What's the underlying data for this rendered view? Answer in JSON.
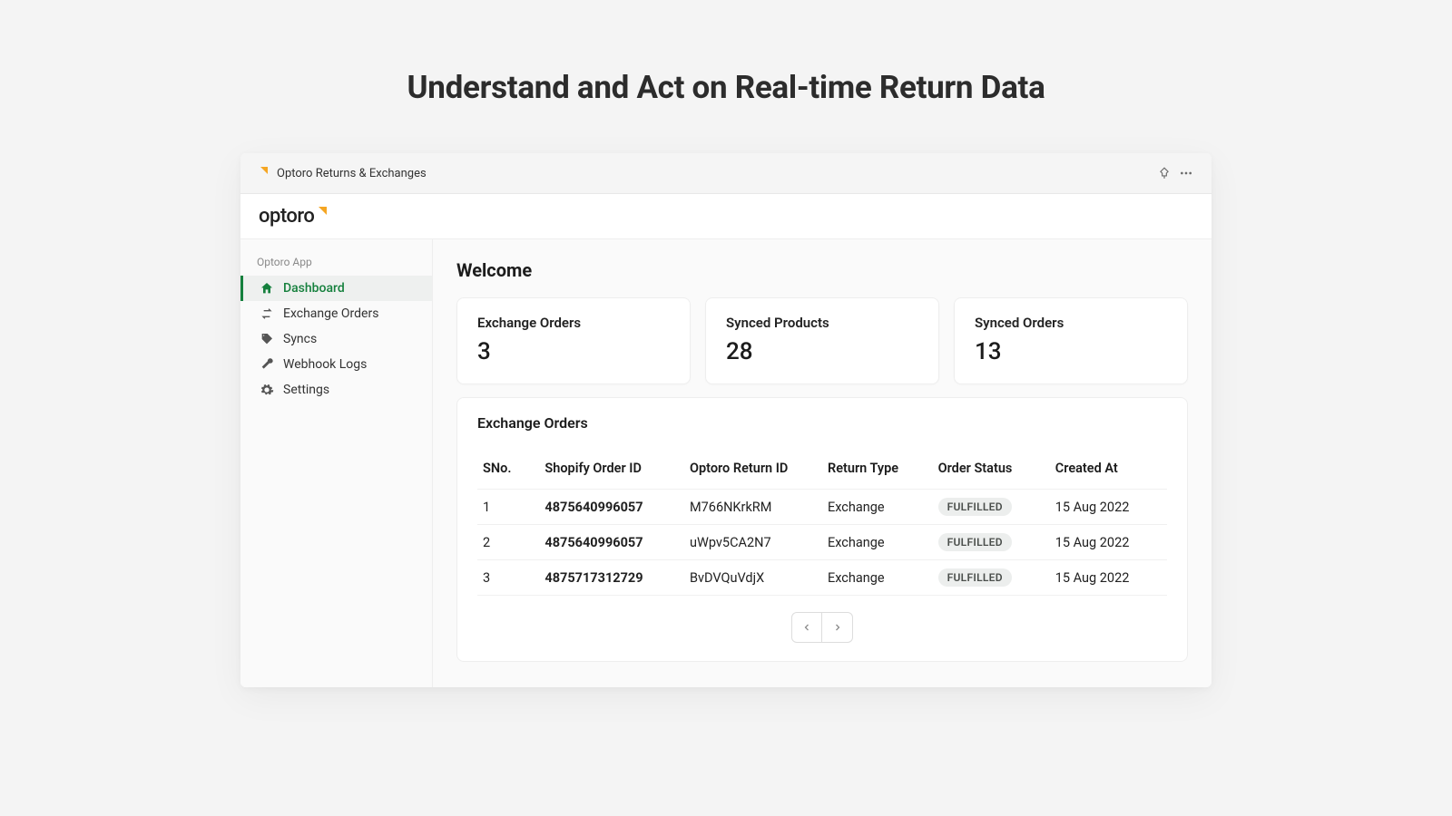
{
  "hero": {
    "title": "Understand and Act on Real-time Return Data"
  },
  "window": {
    "title": "Optoro Returns & Exchanges"
  },
  "brand": {
    "name": "optoro"
  },
  "sidebar": {
    "section_label": "Optoro App",
    "items": [
      {
        "label": "Dashboard",
        "icon": "home-icon",
        "active": true
      },
      {
        "label": "Exchange Orders",
        "icon": "exchange-icon",
        "active": false
      },
      {
        "label": "Syncs",
        "icon": "tag-icon",
        "active": false
      },
      {
        "label": "Webhook Logs",
        "icon": "wrench-icon",
        "active": false
      },
      {
        "label": "Settings",
        "icon": "gear-icon",
        "active": false
      }
    ]
  },
  "main": {
    "title": "Welcome",
    "stats": [
      {
        "label": "Exchange Orders",
        "value": "3"
      },
      {
        "label": "Synced Products",
        "value": "28"
      },
      {
        "label": "Synced Orders",
        "value": "13"
      }
    ],
    "orders_table": {
      "title": "Exchange Orders",
      "columns": [
        "SNo.",
        "Shopify Order ID",
        "Optoro Return ID",
        "Return Type",
        "Order Status",
        "Created At"
      ],
      "rows": [
        {
          "sno": "1",
          "shopify_id": "4875640996057",
          "return_id": "M766NKrkRM",
          "return_type": "Exchange",
          "status": "FULFILLED",
          "created_at": "15 Aug 2022"
        },
        {
          "sno": "2",
          "shopify_id": "4875640996057",
          "return_id": "uWpv5CA2N7",
          "return_type": "Exchange",
          "status": "FULFILLED",
          "created_at": "15 Aug 2022"
        },
        {
          "sno": "3",
          "shopify_id": "4875717312729",
          "return_id": "BvDVQuVdjX",
          "return_type": "Exchange",
          "status": "FULFILLED",
          "created_at": "15 Aug 2022"
        }
      ]
    }
  }
}
